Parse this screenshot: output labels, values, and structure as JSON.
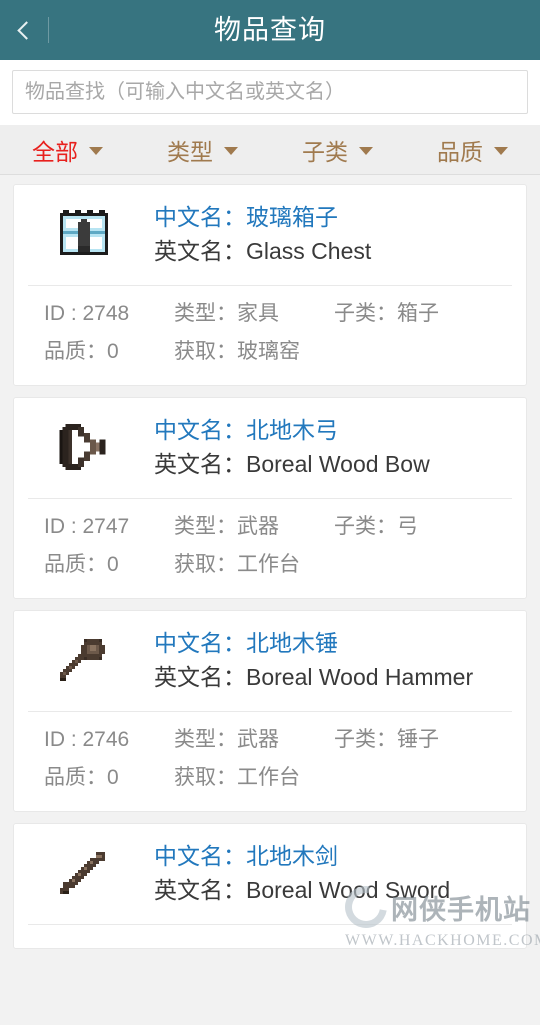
{
  "header": {
    "title": "物品查询",
    "back_icon": "chevron-left-icon",
    "bg_color": "#377480",
    "title_color": "#ffffff"
  },
  "search": {
    "value": "",
    "placeholder": "物品查找（可输入中文名或英文名）"
  },
  "filters": {
    "active_color": "#e8201d",
    "inactive_color": "#a07a4e",
    "items": [
      {
        "label": "全部",
        "active": true,
        "caret_icon": "chevron-down-icon"
      },
      {
        "label": "类型",
        "active": false,
        "caret_icon": "chevron-down-icon"
      },
      {
        "label": "子类",
        "active": false,
        "caret_icon": "chevron-down-icon"
      },
      {
        "label": "品质",
        "active": false,
        "caret_icon": "chevron-down-icon"
      }
    ]
  },
  "labels": {
    "cn_name": "中文名：",
    "en_name": "英文名：",
    "id": "ID：",
    "type": "类型：",
    "subtype": "子类：",
    "quality": "品质：",
    "source": "获取："
  },
  "items": [
    {
      "icon": "glass-chest-icon",
      "cn_line": "中文名：玻璃箱子",
      "en_line": "英文名：Glass Chest",
      "id_line": "ID : 2748",
      "type_line": "类型：家具",
      "subtype_line": "子类：箱子",
      "quality_line": "品质：0",
      "source_line": "获取：玻璃窑"
    },
    {
      "icon": "boreal-wood-bow-icon",
      "cn_line": "中文名：北地木弓",
      "en_line": "英文名：Boreal Wood Bow",
      "id_line": "ID : 2747",
      "type_line": "类型：武器",
      "subtype_line": "子类：弓",
      "quality_line": "品质：0",
      "source_line": "获取：工作台"
    },
    {
      "icon": "boreal-wood-hammer-icon",
      "cn_line": "中文名：北地木锤",
      "en_line": "英文名：Boreal Wood Hammer",
      "id_line": "ID : 2746",
      "type_line": "类型：武器",
      "subtype_line": "子类：锤子",
      "quality_line": "品质：0",
      "source_line": "获取：工作台"
    },
    {
      "icon": "boreal-wood-sword-icon",
      "cn_line": "中文名：北地木剑",
      "en_line": "英文名：Boreal Wood Sword",
      "id_line": "",
      "type_line": "",
      "subtype_line": "",
      "quality_line": "",
      "source_line": ""
    }
  ],
  "watermark": {
    "site_name": "网侠手机站",
    "url": "WWW.HACKHOME.COM",
    "logo_icon": "circle-arrow-logo-icon"
  }
}
